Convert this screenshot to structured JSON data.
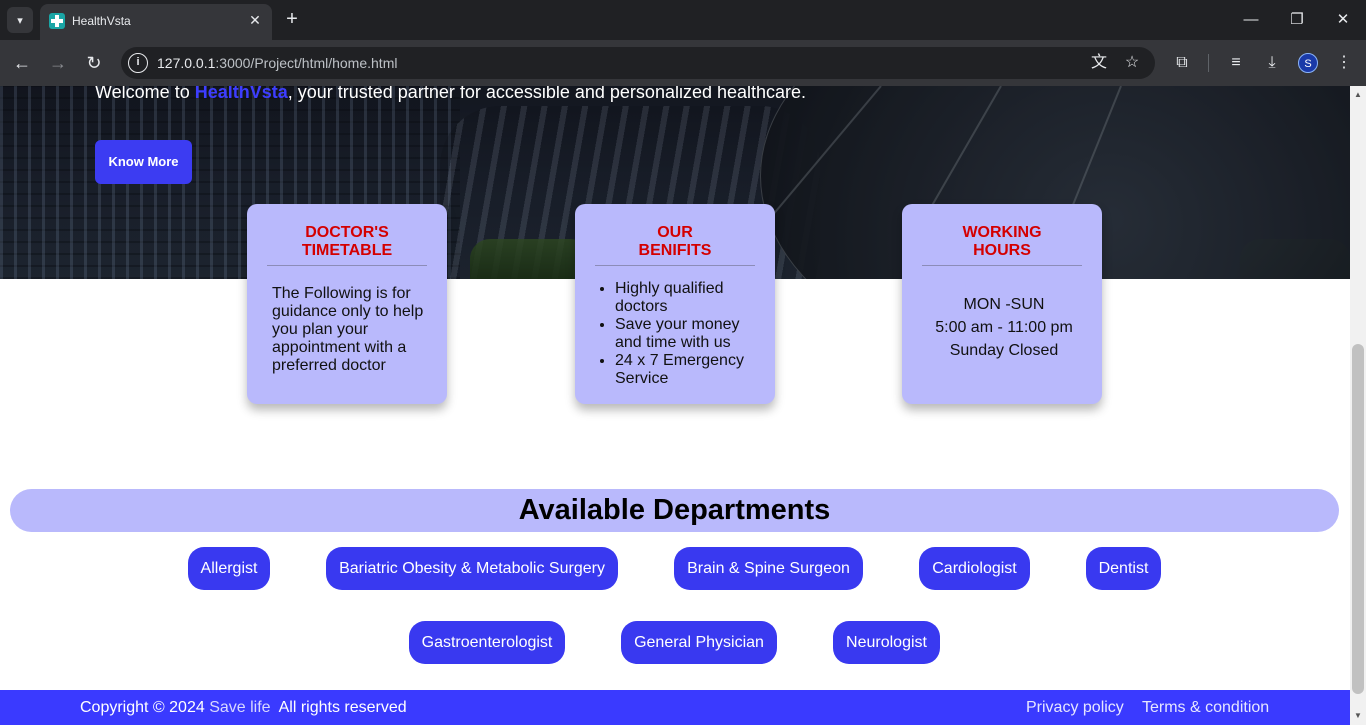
{
  "browser": {
    "tab_title": "HealthVsta",
    "url_host": "127.0.0.1",
    "url_path": ":3000/Project/html/home.html",
    "profile_initial": "S"
  },
  "hero": {
    "welcome_prefix": "Welcome to ",
    "brand": "HealthVsta",
    "welcome_suffix": ", your trusted partner for accessible and personalized healthcare.",
    "know_more_label": "Know More"
  },
  "cards": {
    "timetable": {
      "title_line1": "DOCTOR'S",
      "title_line2": "TIMETABLE",
      "text": "The Following is for guidance only to help you plan your appointment with a preferred doctor"
    },
    "benefits": {
      "title_line1": "OUR",
      "title_line2": "BENIFITS",
      "items": [
        "Highly qualified doctors",
        "Save your money and time with us",
        "24 x 7 Emergency Service"
      ]
    },
    "hours": {
      "title_line1": "WORKING",
      "title_line2": "HOURS",
      "days": "MON -SUN",
      "time": "5:00 am - 11:00 pm",
      "closed": "Sunday Closed"
    }
  },
  "departments": {
    "title": "Available Departments",
    "items": [
      "Allergist",
      "Bariatric Obesity & Metabolic Surgery",
      "Brain & Spine Surgeon",
      "Cardiologist",
      "Dentist",
      "Gastroenterologist",
      "General Physician",
      "Neurologist"
    ]
  },
  "footer": {
    "copyright": "Copyright © 2024 ",
    "org": "Save life",
    "rights": "  All rights reserved",
    "privacy": "Privacy policy",
    "terms": "Terms & condition"
  },
  "colors": {
    "accent": "#3939f0",
    "card_bg": "#b9b9fc",
    "card_title": "#d40000",
    "footer_bg": "#3a3aff"
  }
}
